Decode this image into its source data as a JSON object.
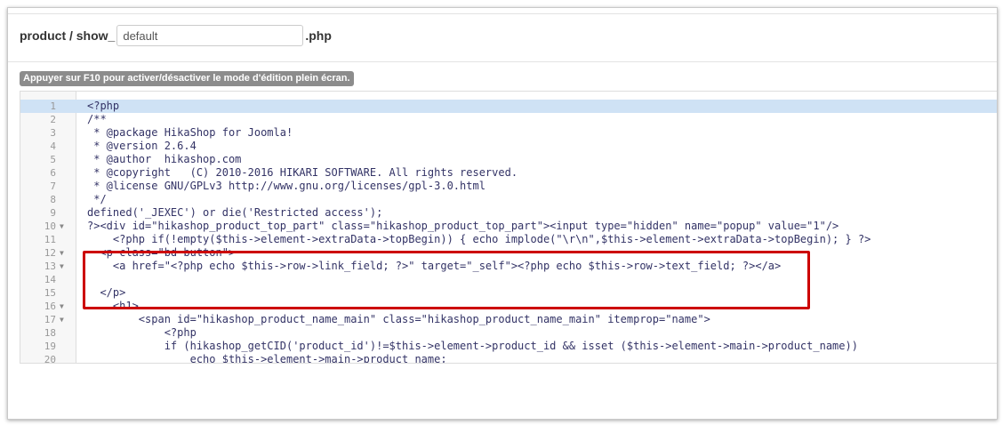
{
  "header": {
    "prefix": "product / show_",
    "input_value": "default",
    "suffix": ".php"
  },
  "hint_text": "Appuyer sur F10 pour activer/désactiver le mode d'édition plein écran.",
  "editor": {
    "lines": [
      {
        "num": "1",
        "text": "<?php",
        "fold": false,
        "active": true
      },
      {
        "num": "2",
        "text": "/**",
        "fold": false,
        "active": false
      },
      {
        "num": "3",
        "text": " * @package HikaShop for Joomla!",
        "fold": false,
        "active": false
      },
      {
        "num": "4",
        "text": " * @version 2.6.4",
        "fold": false,
        "active": false
      },
      {
        "num": "5",
        "text": " * @author  hikashop.com",
        "fold": false,
        "active": false
      },
      {
        "num": "6",
        "text": " * @copyright   (C) 2010-2016 HIKARI SOFTWARE. All rights reserved.",
        "fold": false,
        "active": false
      },
      {
        "num": "7",
        "text": " * @license GNU/GPLv3 http://www.gnu.org/licenses/gpl-3.0.html",
        "fold": false,
        "active": false
      },
      {
        "num": "8",
        "text": " */",
        "fold": false,
        "active": false
      },
      {
        "num": "9",
        "text": "defined('_JEXEC') or die('Restricted access');",
        "fold": false,
        "active": false
      },
      {
        "num": "10",
        "text": "?><div id=\"hikashop_product_top_part\" class=\"hikashop_product_top_part\"><input type=\"hidden\" name=\"popup\" value=\"1\"/>",
        "fold": true,
        "active": false
      },
      {
        "num": "11",
        "text": "    <?php if(!empty($this->element->extraData->topBegin)) { echo implode(\"\\r\\n\",$this->element->extraData->topBegin); } ?>",
        "fold": false,
        "active": false
      },
      {
        "num": "12",
        "text": "  <p class=\"bd-button\">",
        "fold": true,
        "active": false
      },
      {
        "num": "13",
        "text": "    <a href=\"<?php echo $this->row->link_field; ?>\" target=\"_self\"><?php echo $this->row->text_field; ?></a>",
        "fold": true,
        "active": false
      },
      {
        "num": "14",
        "text": "",
        "fold": false,
        "active": false
      },
      {
        "num": "15",
        "text": "  </p>",
        "fold": false,
        "active": false
      },
      {
        "num": "16",
        "text": "    <h1>",
        "fold": true,
        "active": false
      },
      {
        "num": "17",
        "text": "        <span id=\"hikashop_product_name_main\" class=\"hikashop_product_name_main\" itemprop=\"name\">",
        "fold": true,
        "active": false
      },
      {
        "num": "18",
        "text": "            <?php",
        "fold": false,
        "active": false
      },
      {
        "num": "19",
        "text": "            if (hikashop_getCID('product_id')!=$this->element->product_id && isset ($this->element->main->product_name))",
        "fold": false,
        "active": false
      },
      {
        "num": "20",
        "text": "                echo $this->element->main->product_name;",
        "fold": false,
        "active": false
      }
    ]
  },
  "colors": {
    "highlight_border": "#cc0000",
    "active_line": "#cfe2f5",
    "hint_bg": "#8c8c8c"
  }
}
